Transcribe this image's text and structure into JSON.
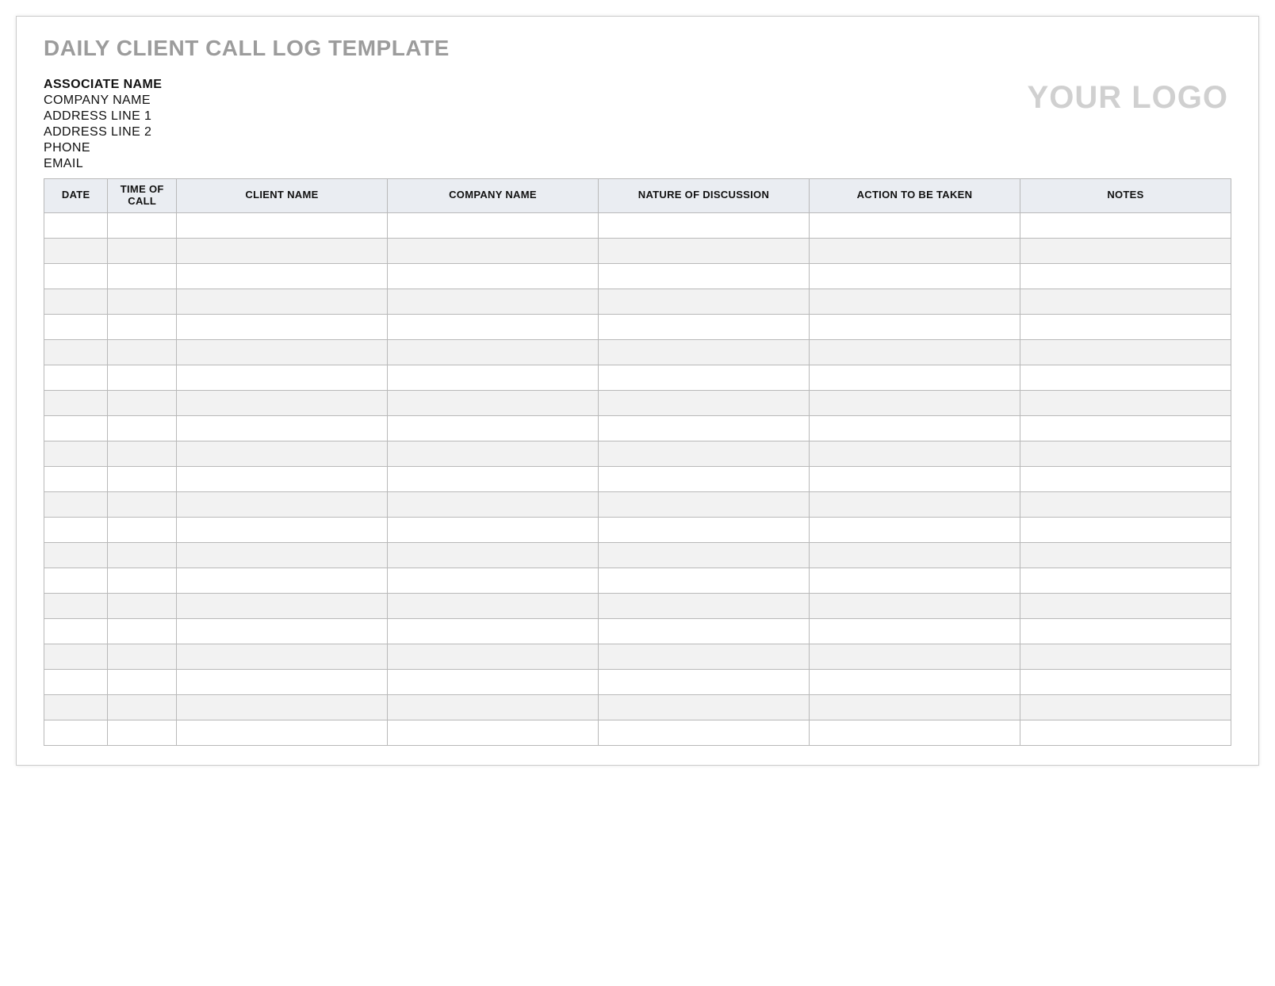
{
  "title": "DAILY CLIENT CALL LOG TEMPLATE",
  "associate": {
    "name_label": "ASSOCIATE NAME",
    "company_label": "COMPANY NAME",
    "address1_label": "ADDRESS LINE 1",
    "address2_label": "ADDRESS LINE 2",
    "phone_label": "PHONE",
    "email_label": "EMAIL"
  },
  "logo_placeholder": "YOUR LOGO",
  "table": {
    "headers": {
      "date": "DATE",
      "time": "TIME OF CALL",
      "client": "CLIENT NAME",
      "company": "COMPANY NAME",
      "nature": "NATURE OF DISCUSSION",
      "action": "ACTION TO BE TAKEN",
      "notes": "NOTES"
    },
    "row_count": 21
  }
}
